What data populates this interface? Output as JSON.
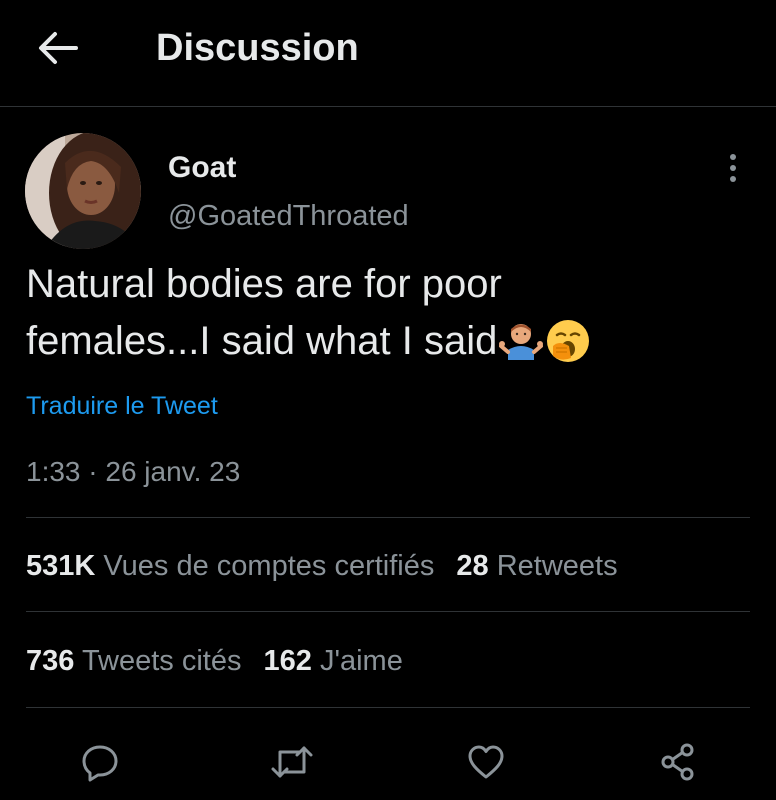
{
  "header": {
    "title": "Discussion",
    "back_icon": "arrow-left-icon"
  },
  "tweet": {
    "display_name": "Goat",
    "handle": "@GoatedThroated",
    "text_line1": "Natural bodies are for poor",
    "text_line2": "females...I said what I said",
    "emojis": [
      "man-shrugging-emoji",
      "yawning-face-emoji"
    ],
    "translate_label": "Traduire le Tweet",
    "timestamp": "1:33 · 26 janv. 23"
  },
  "stats": {
    "views_count": "531K",
    "views_label": "Vues de comptes certifiés",
    "retweets_count": "28",
    "retweets_label": "Retweets",
    "quotes_count": "736",
    "quotes_label": "Tweets cités",
    "likes_count": "162",
    "likes_label": "J'aime"
  },
  "actions": [
    "reply-icon",
    "retweet-icon",
    "like-icon",
    "share-icon"
  ],
  "colors": {
    "background": "#000000",
    "text_primary": "#e7e9ea",
    "text_secondary": "#8b9399",
    "link": "#1d9bf0",
    "divider": "#2f3336"
  }
}
